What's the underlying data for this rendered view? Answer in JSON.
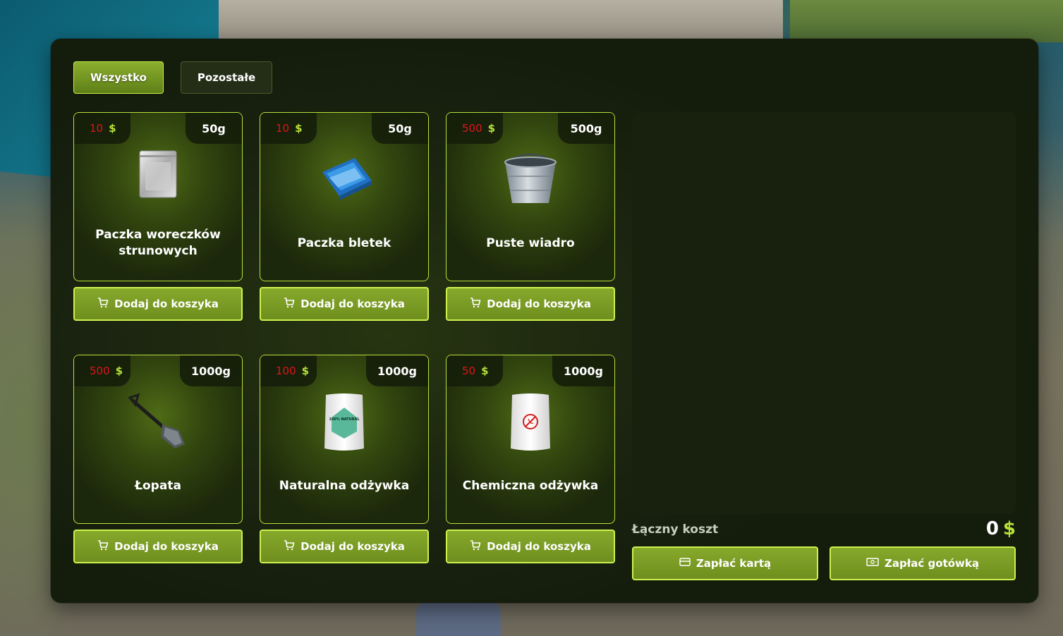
{
  "tabs": [
    {
      "label": "Wszystko",
      "active": true
    },
    {
      "label": "Pozostałe",
      "active": false
    }
  ],
  "currency": "$",
  "items": [
    {
      "price": "10",
      "weight": "50g",
      "name": "Paczka woreczków strunowych",
      "icon": "ziplock-bag-pack-icon"
    },
    {
      "price": "10",
      "weight": "50g",
      "name": "Paczka bletek",
      "icon": "rolling-papers-icon"
    },
    {
      "price": "500",
      "weight": "500g",
      "name": "Puste wiadro",
      "icon": "bucket-icon"
    },
    {
      "price": "500",
      "weight": "1000g",
      "name": "Łopata",
      "icon": "shovel-icon"
    },
    {
      "price": "100",
      "weight": "1000g",
      "name": "Naturalna odżywka",
      "icon": "natural-fertilizer-bag-icon"
    },
    {
      "price": "50",
      "weight": "1000g",
      "name": "Chemiczna odżywka",
      "icon": "chemical-fertilizer-bag-icon"
    }
  ],
  "add_to_cart_label": "Dodaj do koszyka",
  "natural_bag_label": "100% NATURAL",
  "cart": {
    "total_label": "Łączny koszt",
    "total_value": "0",
    "pay_card_label": "Zapłać kartą",
    "pay_cash_label": "Zapłać gotówką"
  },
  "colors": {
    "accent": "#b7e23a",
    "price": "#e0141a",
    "button": "#7a9a24"
  }
}
